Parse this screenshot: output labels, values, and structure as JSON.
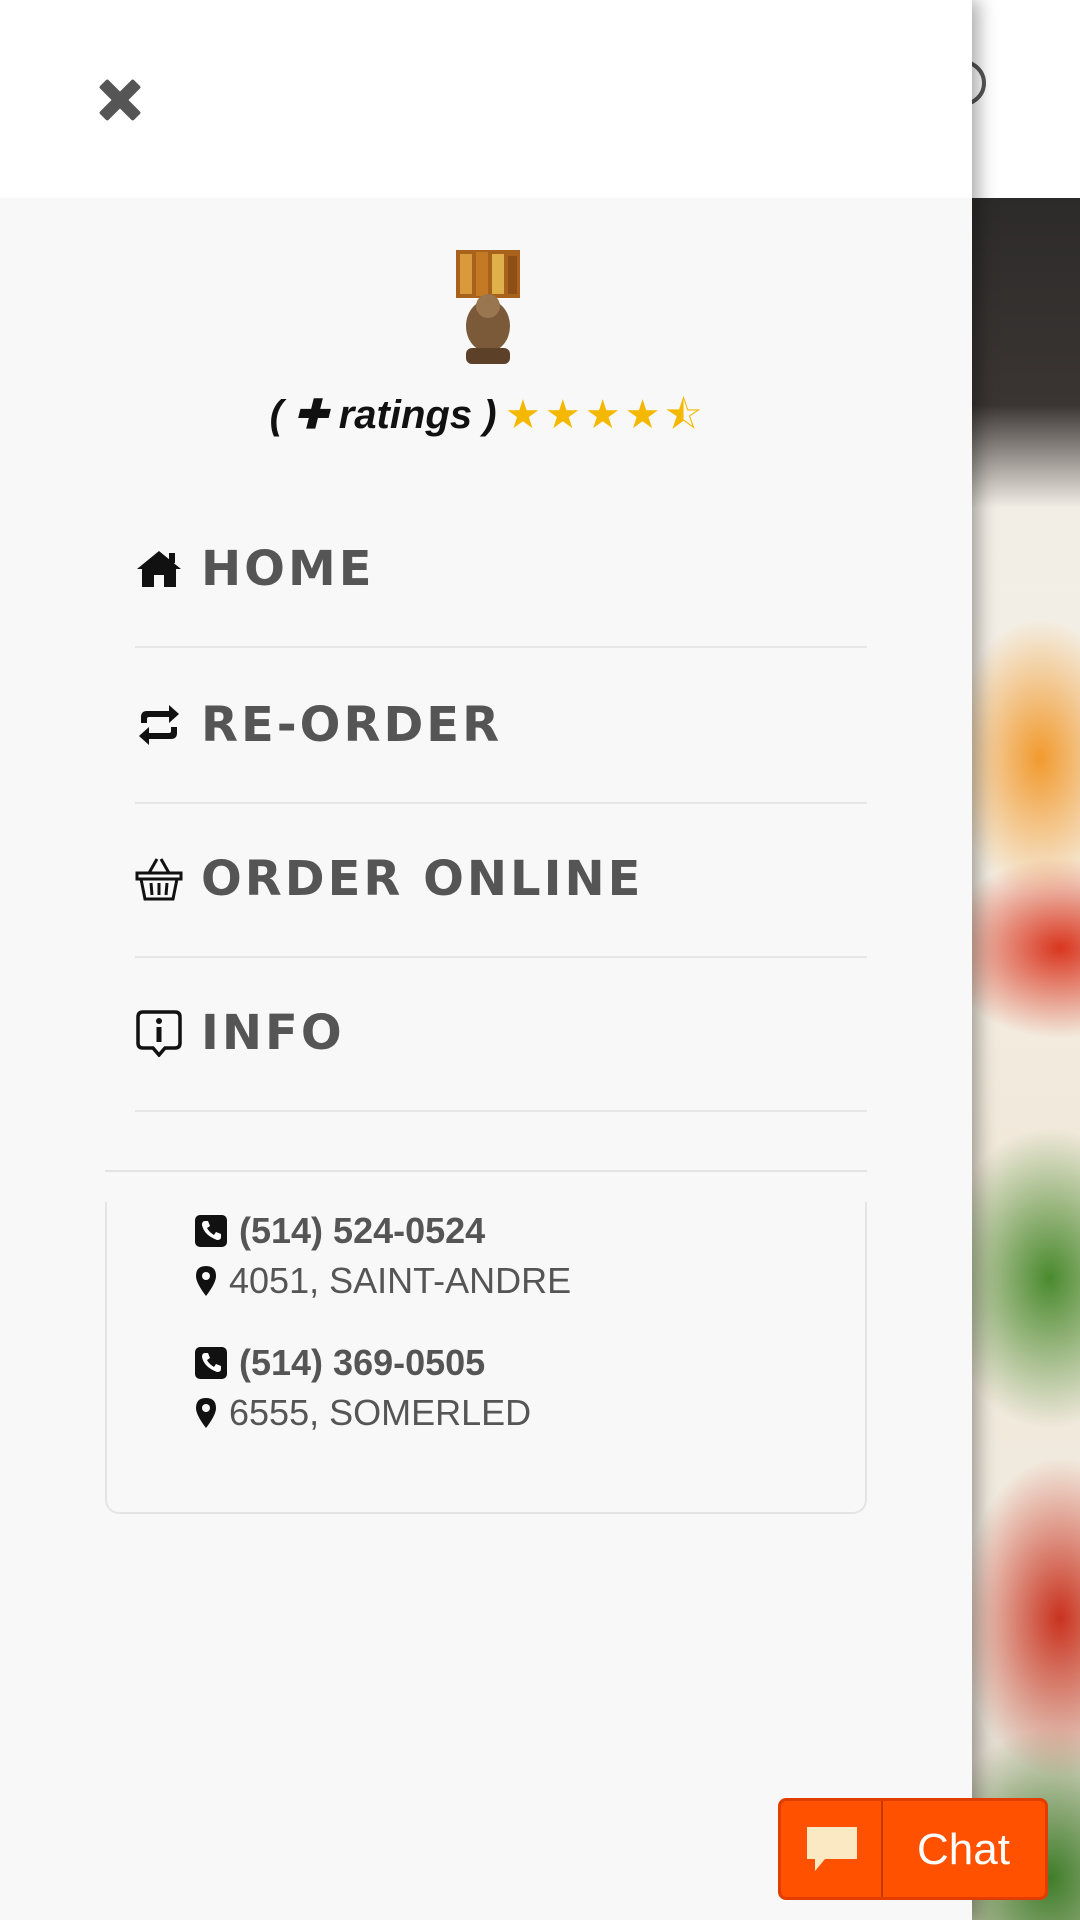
{
  "drawer": {
    "ratings_label": "( ✚ ratings )",
    "rating_stars": 4.5,
    "menu": [
      {
        "label": "HOME",
        "icon": "home-icon"
      },
      {
        "label": "RE-ORDER",
        "icon": "retweet-icon"
      },
      {
        "label": "ORDER ONLINE",
        "icon": "basket-icon"
      },
      {
        "label": "INFO",
        "icon": "info-icon"
      }
    ],
    "locations": [
      {
        "phone": "(514) 524-0524",
        "address": "4051, SAINT-ANDRE"
      },
      {
        "phone": "(514) 369-0505",
        "address": "6555, SOMERLED"
      }
    ]
  },
  "chat": {
    "label": "Chat",
    "icon": "chat-bubble-icon"
  },
  "colors": {
    "accent_orange": "#ff5100",
    "star": "#f5b800",
    "menu_text": "#555555"
  }
}
